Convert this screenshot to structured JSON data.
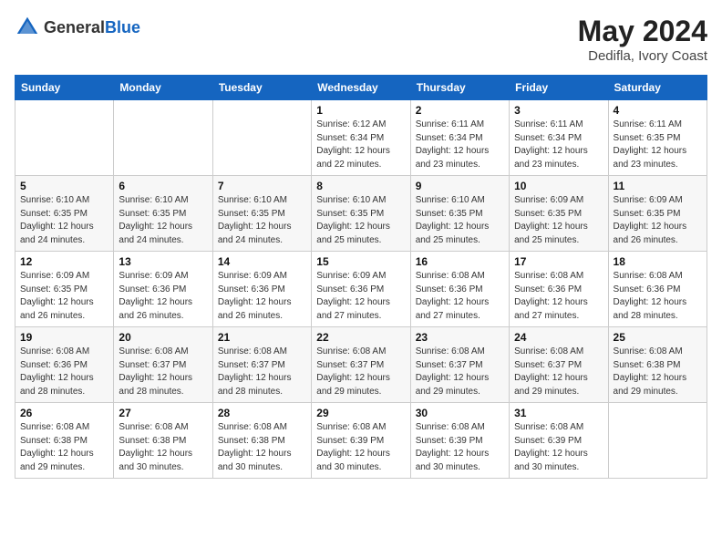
{
  "header": {
    "logo_general": "General",
    "logo_blue": "Blue",
    "month_year": "May 2024",
    "location": "Dedifla, Ivory Coast"
  },
  "weekdays": [
    "Sunday",
    "Monday",
    "Tuesday",
    "Wednesday",
    "Thursday",
    "Friday",
    "Saturday"
  ],
  "weeks": [
    [
      {
        "day": "",
        "sunrise": "",
        "sunset": "",
        "daylight": ""
      },
      {
        "day": "",
        "sunrise": "",
        "sunset": "",
        "daylight": ""
      },
      {
        "day": "",
        "sunrise": "",
        "sunset": "",
        "daylight": ""
      },
      {
        "day": "1",
        "sunrise": "Sunrise: 6:12 AM",
        "sunset": "Sunset: 6:34 PM",
        "daylight": "Daylight: 12 hours and 22 minutes."
      },
      {
        "day": "2",
        "sunrise": "Sunrise: 6:11 AM",
        "sunset": "Sunset: 6:34 PM",
        "daylight": "Daylight: 12 hours and 23 minutes."
      },
      {
        "day": "3",
        "sunrise": "Sunrise: 6:11 AM",
        "sunset": "Sunset: 6:34 PM",
        "daylight": "Daylight: 12 hours and 23 minutes."
      },
      {
        "day": "4",
        "sunrise": "Sunrise: 6:11 AM",
        "sunset": "Sunset: 6:35 PM",
        "daylight": "Daylight: 12 hours and 23 minutes."
      }
    ],
    [
      {
        "day": "5",
        "sunrise": "Sunrise: 6:10 AM",
        "sunset": "Sunset: 6:35 PM",
        "daylight": "Daylight: 12 hours and 24 minutes."
      },
      {
        "day": "6",
        "sunrise": "Sunrise: 6:10 AM",
        "sunset": "Sunset: 6:35 PM",
        "daylight": "Daylight: 12 hours and 24 minutes."
      },
      {
        "day": "7",
        "sunrise": "Sunrise: 6:10 AM",
        "sunset": "Sunset: 6:35 PM",
        "daylight": "Daylight: 12 hours and 24 minutes."
      },
      {
        "day": "8",
        "sunrise": "Sunrise: 6:10 AM",
        "sunset": "Sunset: 6:35 PM",
        "daylight": "Daylight: 12 hours and 25 minutes."
      },
      {
        "day": "9",
        "sunrise": "Sunrise: 6:10 AM",
        "sunset": "Sunset: 6:35 PM",
        "daylight": "Daylight: 12 hours and 25 minutes."
      },
      {
        "day": "10",
        "sunrise": "Sunrise: 6:09 AM",
        "sunset": "Sunset: 6:35 PM",
        "daylight": "Daylight: 12 hours and 25 minutes."
      },
      {
        "day": "11",
        "sunrise": "Sunrise: 6:09 AM",
        "sunset": "Sunset: 6:35 PM",
        "daylight": "Daylight: 12 hours and 26 minutes."
      }
    ],
    [
      {
        "day": "12",
        "sunrise": "Sunrise: 6:09 AM",
        "sunset": "Sunset: 6:35 PM",
        "daylight": "Daylight: 12 hours and 26 minutes."
      },
      {
        "day": "13",
        "sunrise": "Sunrise: 6:09 AM",
        "sunset": "Sunset: 6:36 PM",
        "daylight": "Daylight: 12 hours and 26 minutes."
      },
      {
        "day": "14",
        "sunrise": "Sunrise: 6:09 AM",
        "sunset": "Sunset: 6:36 PM",
        "daylight": "Daylight: 12 hours and 26 minutes."
      },
      {
        "day": "15",
        "sunrise": "Sunrise: 6:09 AM",
        "sunset": "Sunset: 6:36 PM",
        "daylight": "Daylight: 12 hours and 27 minutes."
      },
      {
        "day": "16",
        "sunrise": "Sunrise: 6:08 AM",
        "sunset": "Sunset: 6:36 PM",
        "daylight": "Daylight: 12 hours and 27 minutes."
      },
      {
        "day": "17",
        "sunrise": "Sunrise: 6:08 AM",
        "sunset": "Sunset: 6:36 PM",
        "daylight": "Daylight: 12 hours and 27 minutes."
      },
      {
        "day": "18",
        "sunrise": "Sunrise: 6:08 AM",
        "sunset": "Sunset: 6:36 PM",
        "daylight": "Daylight: 12 hours and 28 minutes."
      }
    ],
    [
      {
        "day": "19",
        "sunrise": "Sunrise: 6:08 AM",
        "sunset": "Sunset: 6:36 PM",
        "daylight": "Daylight: 12 hours and 28 minutes."
      },
      {
        "day": "20",
        "sunrise": "Sunrise: 6:08 AM",
        "sunset": "Sunset: 6:37 PM",
        "daylight": "Daylight: 12 hours and 28 minutes."
      },
      {
        "day": "21",
        "sunrise": "Sunrise: 6:08 AM",
        "sunset": "Sunset: 6:37 PM",
        "daylight": "Daylight: 12 hours and 28 minutes."
      },
      {
        "day": "22",
        "sunrise": "Sunrise: 6:08 AM",
        "sunset": "Sunset: 6:37 PM",
        "daylight": "Daylight: 12 hours and 29 minutes."
      },
      {
        "day": "23",
        "sunrise": "Sunrise: 6:08 AM",
        "sunset": "Sunset: 6:37 PM",
        "daylight": "Daylight: 12 hours and 29 minutes."
      },
      {
        "day": "24",
        "sunrise": "Sunrise: 6:08 AM",
        "sunset": "Sunset: 6:37 PM",
        "daylight": "Daylight: 12 hours and 29 minutes."
      },
      {
        "day": "25",
        "sunrise": "Sunrise: 6:08 AM",
        "sunset": "Sunset: 6:38 PM",
        "daylight": "Daylight: 12 hours and 29 minutes."
      }
    ],
    [
      {
        "day": "26",
        "sunrise": "Sunrise: 6:08 AM",
        "sunset": "Sunset: 6:38 PM",
        "daylight": "Daylight: 12 hours and 29 minutes."
      },
      {
        "day": "27",
        "sunrise": "Sunrise: 6:08 AM",
        "sunset": "Sunset: 6:38 PM",
        "daylight": "Daylight: 12 hours and 30 minutes."
      },
      {
        "day": "28",
        "sunrise": "Sunrise: 6:08 AM",
        "sunset": "Sunset: 6:38 PM",
        "daylight": "Daylight: 12 hours and 30 minutes."
      },
      {
        "day": "29",
        "sunrise": "Sunrise: 6:08 AM",
        "sunset": "Sunset: 6:39 PM",
        "daylight": "Daylight: 12 hours and 30 minutes."
      },
      {
        "day": "30",
        "sunrise": "Sunrise: 6:08 AM",
        "sunset": "Sunset: 6:39 PM",
        "daylight": "Daylight: 12 hours and 30 minutes."
      },
      {
        "day": "31",
        "sunrise": "Sunrise: 6:08 AM",
        "sunset": "Sunset: 6:39 PM",
        "daylight": "Daylight: 12 hours and 30 minutes."
      },
      {
        "day": "",
        "sunrise": "",
        "sunset": "",
        "daylight": ""
      }
    ]
  ]
}
